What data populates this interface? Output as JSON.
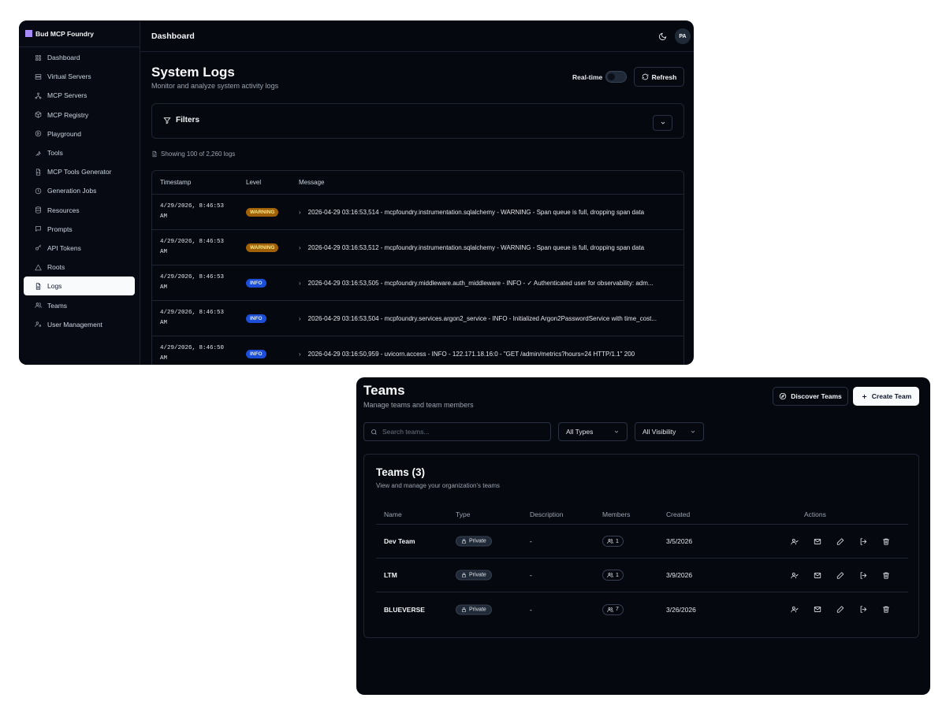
{
  "logs_window": {
    "brand": "Bud MCP Foundry",
    "sidebar": {
      "items": [
        {
          "label": "Dashboard",
          "icon": "grid-icon"
        },
        {
          "label": "Virtual Servers",
          "icon": "server-icon"
        },
        {
          "label": "MCP Servers",
          "icon": "network-icon"
        },
        {
          "label": "MCP Registry",
          "icon": "package-icon"
        },
        {
          "label": "Playground",
          "icon": "play-icon"
        },
        {
          "label": "Tools",
          "icon": "wrench-icon"
        },
        {
          "label": "MCP Tools Generator",
          "icon": "file-code-icon"
        },
        {
          "label": "Generation Jobs",
          "icon": "clock-icon"
        },
        {
          "label": "Resources",
          "icon": "database-icon"
        },
        {
          "label": "Prompts",
          "icon": "message-icon"
        },
        {
          "label": "API Tokens",
          "icon": "key-icon"
        },
        {
          "label": "Roots",
          "icon": "triangle-icon"
        },
        {
          "label": "Logs",
          "icon": "file-text-icon",
          "active": true
        },
        {
          "label": "Teams",
          "icon": "users-icon"
        },
        {
          "label": "User Management",
          "icon": "user-cog-icon"
        }
      ]
    },
    "topbar": {
      "title": "Dashboard",
      "avatar": "PA"
    },
    "page": {
      "title": "System Logs",
      "subtitle": "Monitor and analyze system activity logs",
      "realtime_label": "Real-time",
      "realtime_on": false,
      "refresh_label": "Refresh",
      "filters_label": "Filters",
      "showing": "Showing 100 of 2,260 logs"
    },
    "table": {
      "headers": {
        "timestamp": "Timestamp",
        "level": "Level",
        "message": "Message"
      },
      "rows": [
        {
          "timestamp": "4/29/2026, 8:46:53\nAM",
          "level": "WARNING",
          "message": "2026-04-29 03:16:53,514 - mcpfoundry.instrumentation.sqlalchemy - WARNING - Span queue is full, dropping span data"
        },
        {
          "timestamp": "4/29/2026, 8:46:53\nAM",
          "level": "WARNING",
          "message": "2026-04-29 03:16:53,512 - mcpfoundry.instrumentation.sqlalchemy - WARNING - Span queue is full, dropping span data"
        },
        {
          "timestamp": "4/29/2026, 8:46:53\nAM",
          "level": "INFO",
          "message": "2026-04-29 03:16:53,505 - mcpfoundry.middleware.auth_middleware - INFO - ✓ Authenticated user for observability: adm..."
        },
        {
          "timestamp": "4/29/2026, 8:46:53\nAM",
          "level": "INFO",
          "message": "2026-04-29 03:16:53,504 - mcpfoundry.services.argon2_service - INFO - Initialized Argon2PasswordService with time_cost..."
        },
        {
          "timestamp": "4/29/2026, 8:46:50\nAM",
          "level": "INFO",
          "message": "2026-04-29 03:16:50,959 - uvicorn.access - INFO - 122.171.18.16:0 - \"GET /admin/metrics?hours=24 HTTP/1.1\" 200"
        }
      ]
    }
  },
  "teams_window": {
    "title": "Teams",
    "subtitle": "Manage teams and team members",
    "discover_label": "Discover Teams",
    "create_label": "Create Team",
    "search_placeholder": "Search teams...",
    "type_filter": "All Types",
    "visibility_filter": "All Visibility",
    "card": {
      "title": "Teams (3)",
      "subtitle": "View and manage your organization's teams",
      "headers": {
        "name": "Name",
        "type": "Type",
        "description": "Description",
        "members": "Members",
        "created": "Created",
        "actions": "Actions"
      },
      "rows": [
        {
          "name": "Dev Team",
          "type": "Private",
          "description": "-",
          "members": "1",
          "created": "3/5/2026"
        },
        {
          "name": "LTM",
          "type": "Private",
          "description": "-",
          "members": "1",
          "created": "3/9/2026"
        },
        {
          "name": "BLUEVERSE",
          "type": "Private",
          "description": "-",
          "members": "7",
          "created": "3/26/2026"
        }
      ]
    }
  }
}
